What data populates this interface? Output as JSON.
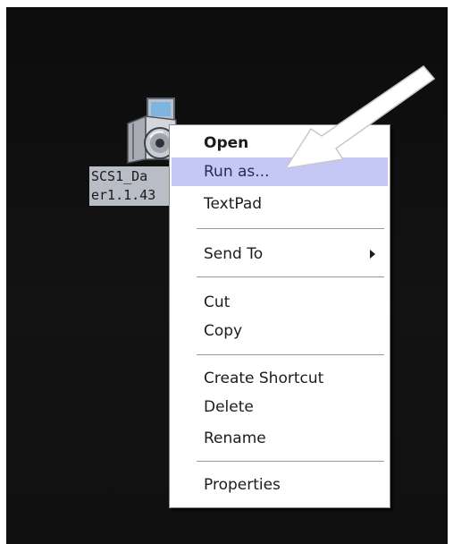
{
  "desktop_icon": {
    "label_lines": [
      "SCS1_Da",
      "er1.1.43"
    ],
    "icon": "installer-cd-icon"
  },
  "context_menu": {
    "items": [
      {
        "label": "Open",
        "bold": true
      },
      {
        "label": "Run as...",
        "highlighted": true
      },
      {
        "label": "TextPad"
      },
      {
        "label": "Send To",
        "submenu": true
      },
      {
        "label": "Cut"
      },
      {
        "label": "Copy"
      },
      {
        "label": "Create Shortcut"
      },
      {
        "label": "Delete"
      },
      {
        "label": "Rename"
      },
      {
        "label": "Properties"
      }
    ]
  },
  "colors": {
    "desktop": "#111111",
    "highlight": "#c5c8f5",
    "icon_label_bg": "#b9bec6",
    "arrow": "#ffffff"
  }
}
